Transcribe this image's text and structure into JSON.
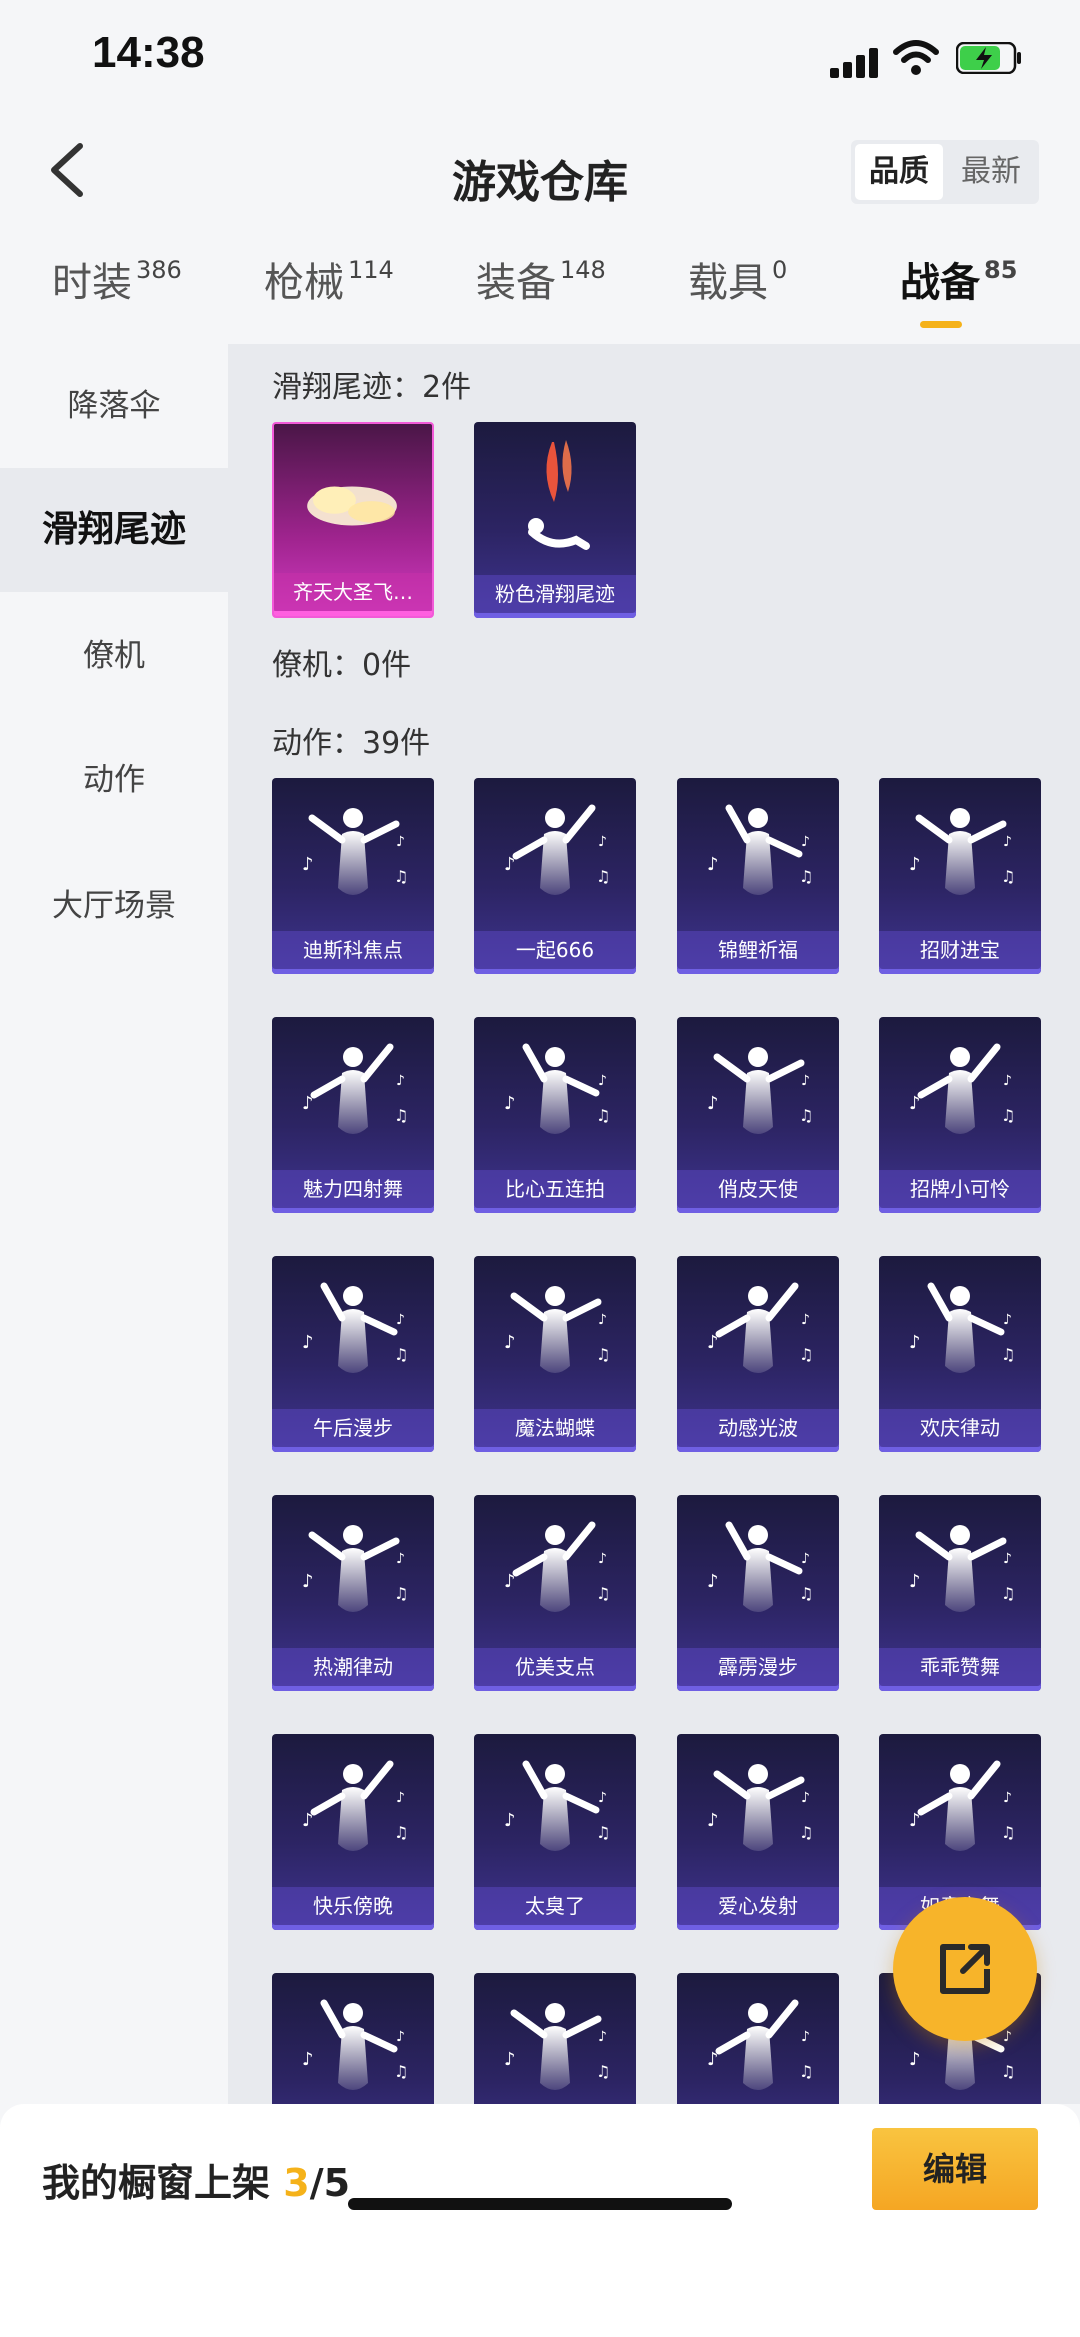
{
  "status": {
    "time": "14:38"
  },
  "header": {
    "title": "游戏仓库",
    "sort": [
      "品质",
      "最新"
    ]
  },
  "tabs": [
    {
      "label": "时装",
      "count": "386"
    },
    {
      "label": "枪械",
      "count": "114"
    },
    {
      "label": "装备",
      "count": "148"
    },
    {
      "label": "载具",
      "count": "0"
    },
    {
      "label": "战备",
      "count": "85"
    }
  ],
  "sidebar": [
    "降落伞",
    "滑翔尾迹",
    "僚机",
    "动作",
    "大厅场景"
  ],
  "sections": {
    "glide": {
      "title": "滑翔尾迹：2件",
      "items": [
        "齐天大圣飞…",
        "粉色滑翔尾迹"
      ]
    },
    "wingman": {
      "title": "僚机：0件"
    },
    "emotes": {
      "title": "动作：39件",
      "items": [
        "迪斯科焦点",
        "一起666",
        "锦鲤祈福",
        "招财进宝",
        "魅力四射舞",
        "比心五连拍",
        "俏皮天使",
        "招牌小可怜",
        "午后漫步",
        "魔法蝴蝶",
        "动感光波",
        "欢庆律动",
        "热潮律动",
        "优美支点",
        "霹雳漫步",
        "乖乖赞舞",
        "快乐傍晚",
        "太臭了",
        "爱心发射",
        "如意之舞",
        "",
        "",
        "",
        ""
      ]
    }
  },
  "bottom": {
    "label": "我的橱窗上架 ",
    "current": "3",
    "total": "/5",
    "edit": "编辑"
  },
  "colors": {
    "accent": "#f5b21a",
    "card": "#2c2463",
    "card_border": "#6f5fe3",
    "pink": "#d13bc2"
  }
}
